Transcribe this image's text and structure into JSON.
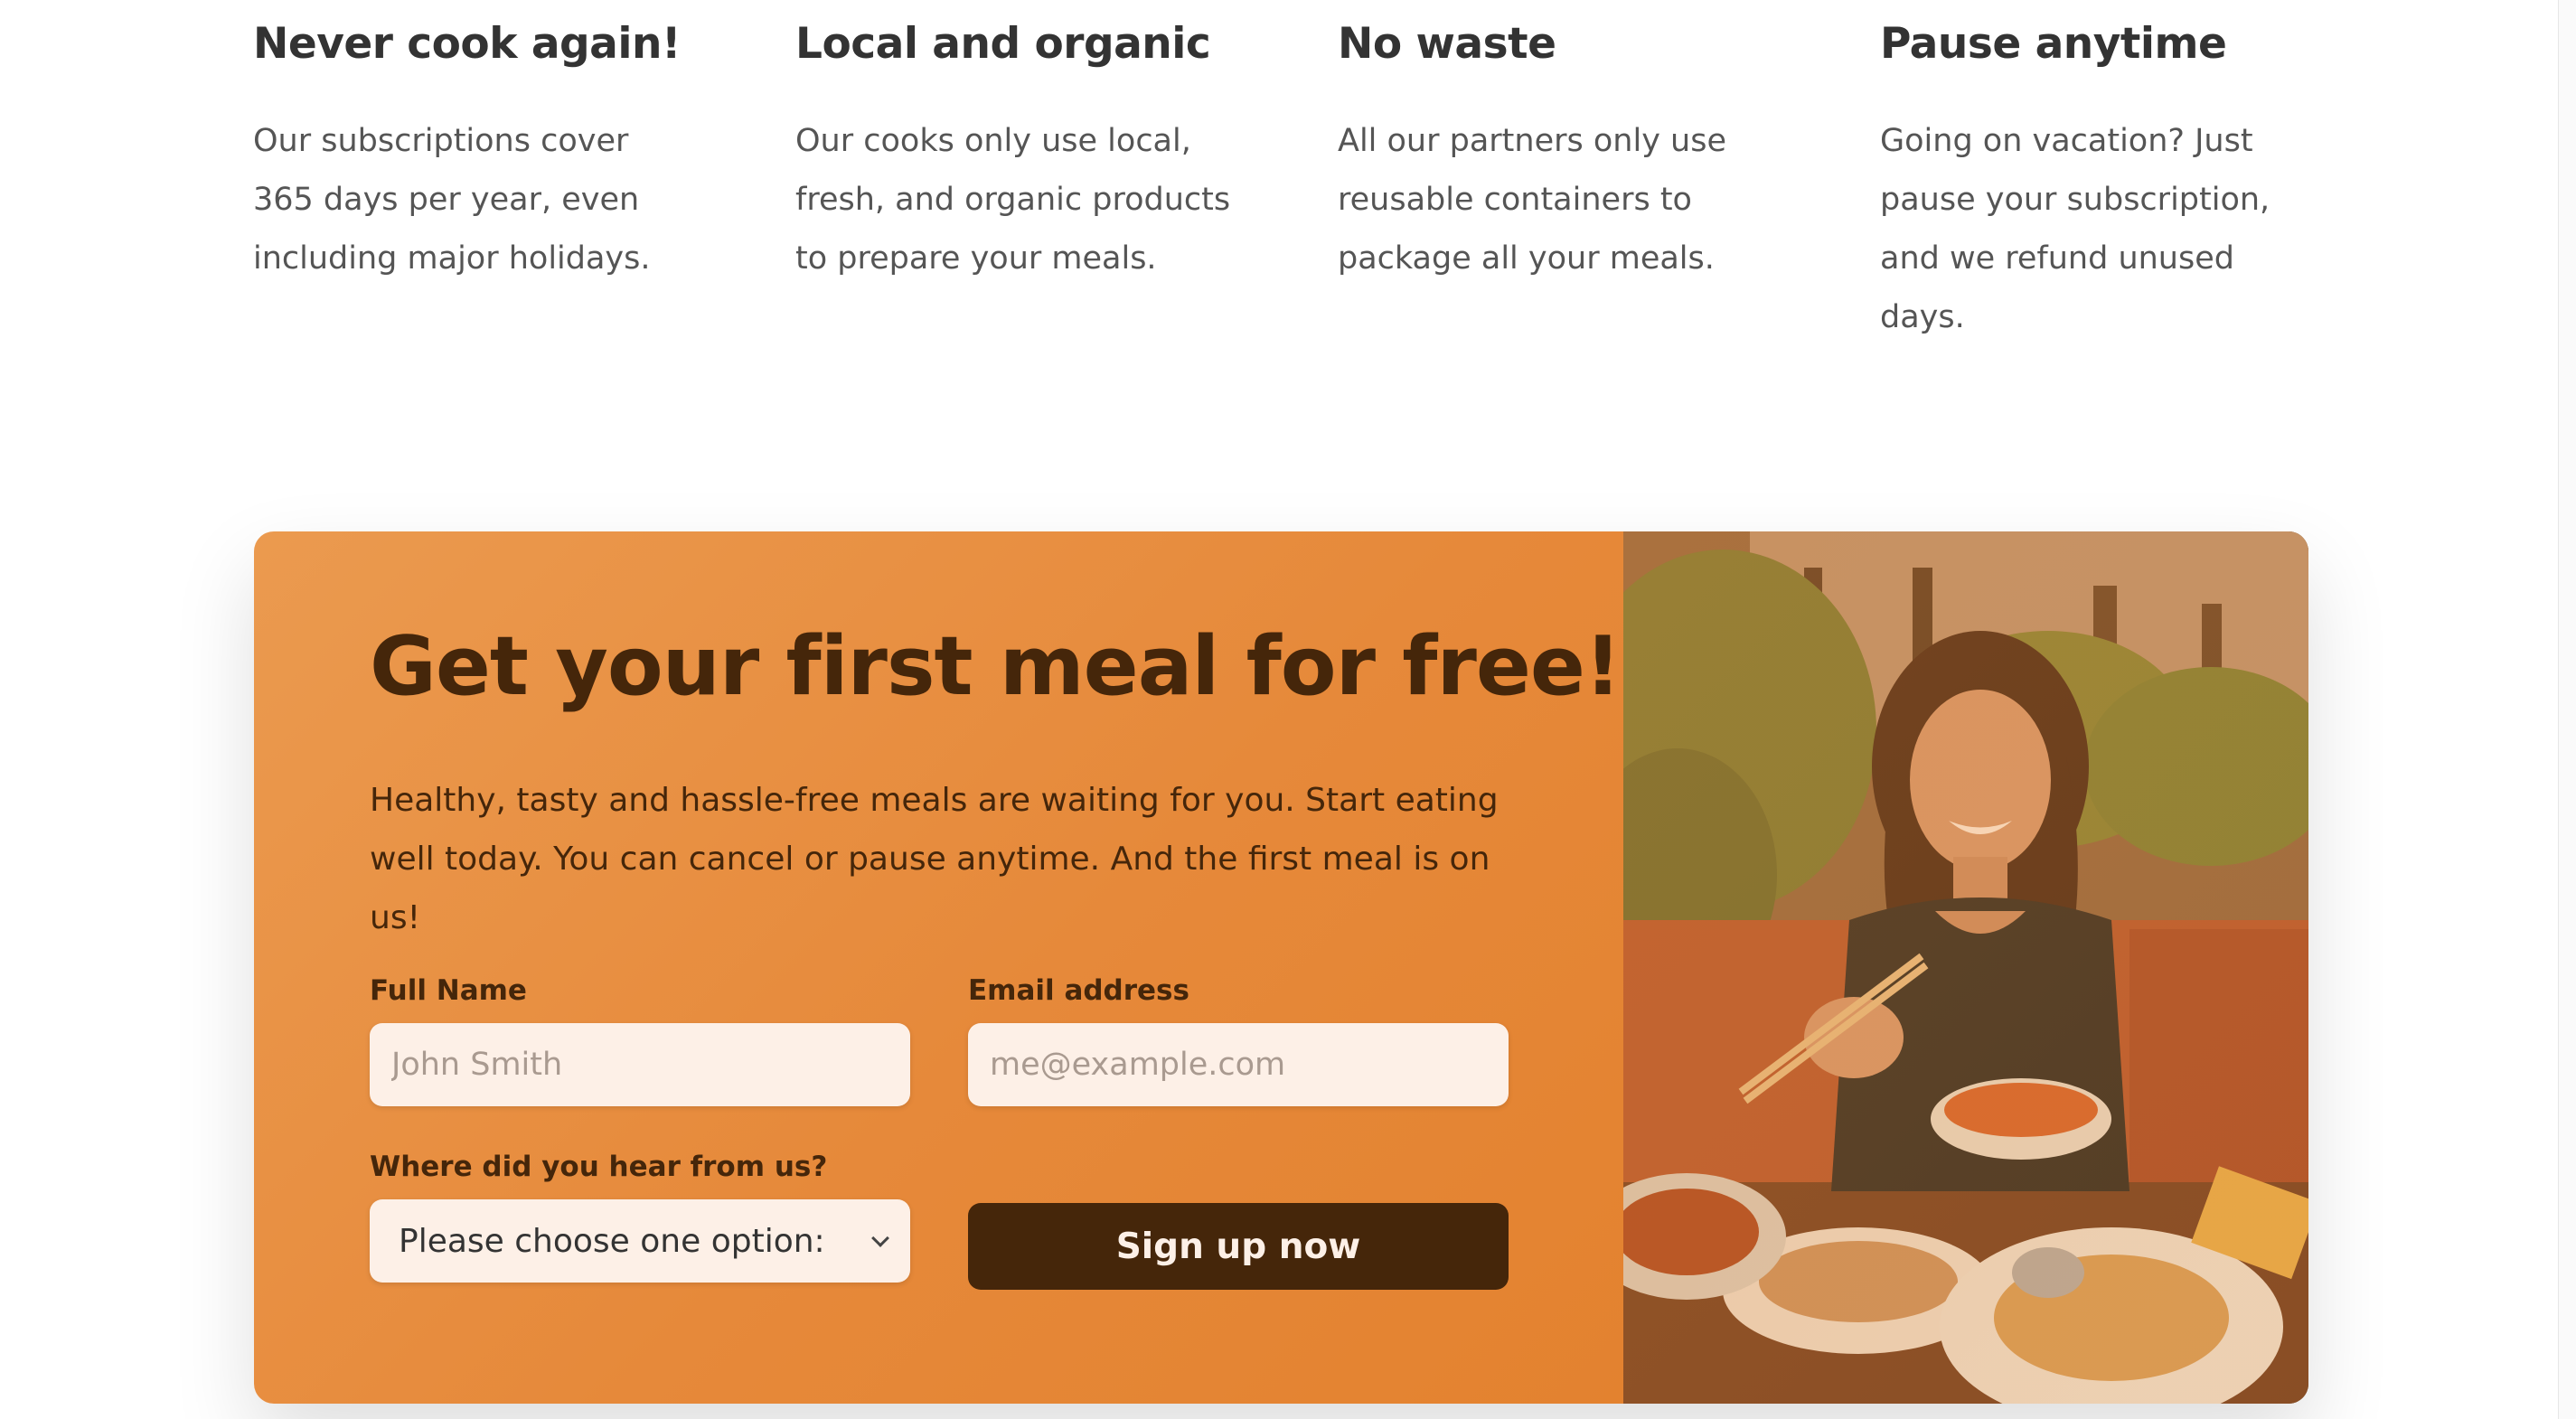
{
  "features": [
    {
      "title": "Never cook again!",
      "text": "Our subscriptions cover 365 days per year, even including major holidays."
    },
    {
      "title": "Local and organic",
      "text": "Our cooks only use local, fresh, and organic products to prepare your meals."
    },
    {
      "title": "No waste",
      "text": "All our partners only use reusable containers to package all your meals."
    },
    {
      "title": "Pause anytime",
      "text": "Going on vacation? Just pause your subscription, and we refund unused days."
    }
  ],
  "cta": {
    "heading": "Get your first meal for free!",
    "description": "Healthy, tasty and hassle-free meals are waiting for you. Start eating well today. You can cancel or pause anytime. And the first meal is on us!",
    "form": {
      "full_name_label": "Full Name",
      "full_name_placeholder": "John Smith",
      "email_label": "Email address",
      "email_placeholder": "me@example.com",
      "source_label": "Where did you hear from us?",
      "source_selected": "Please choose one option:",
      "submit_label": "Sign up now"
    }
  },
  "colors": {
    "cta_background": "#e6893a",
    "cta_text": "#45260a",
    "input_background": "#fdf0e7",
    "button_background": "#45260a"
  }
}
